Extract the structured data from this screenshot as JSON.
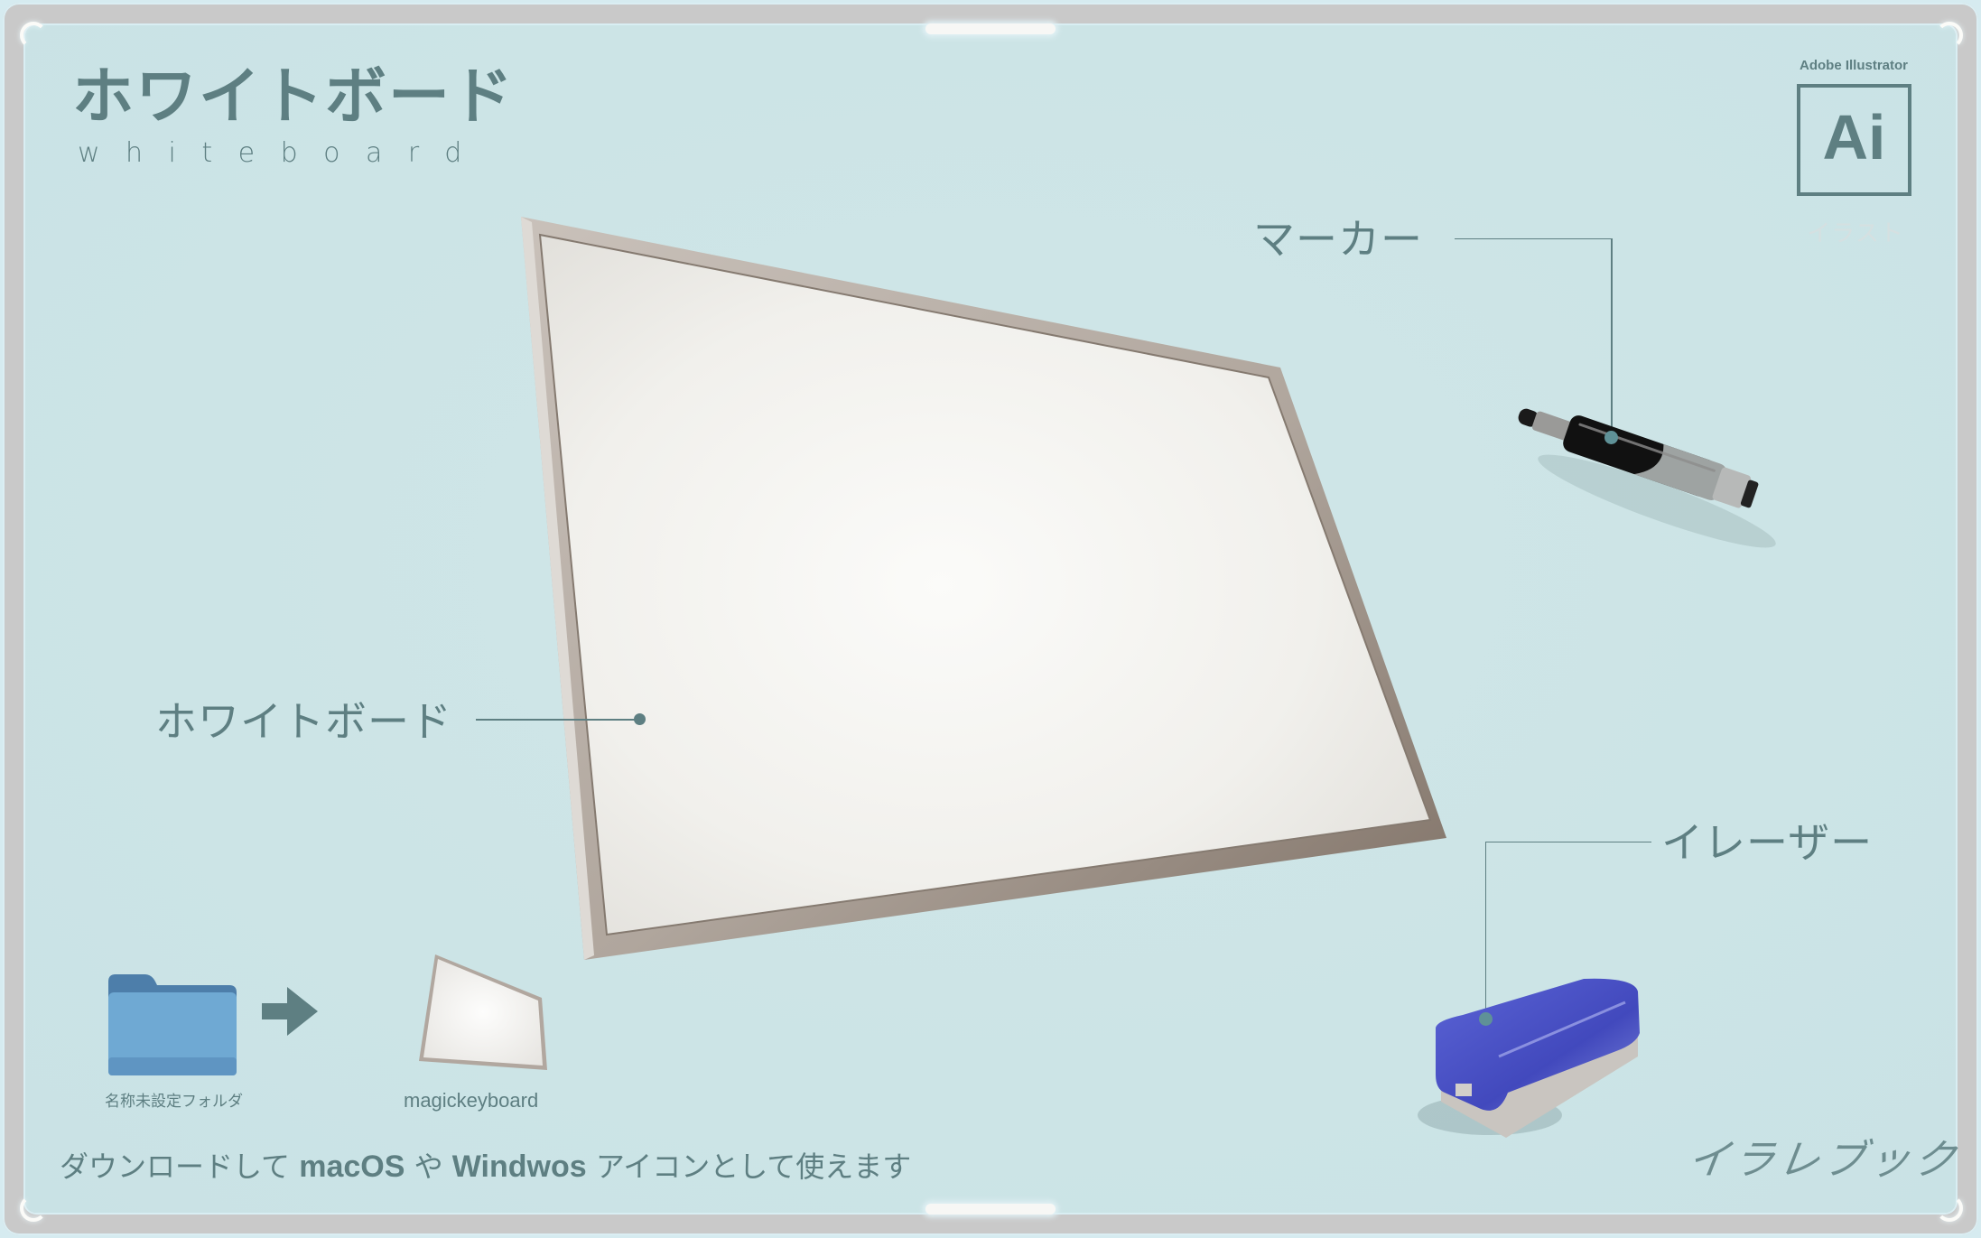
{
  "title": {
    "japanese": "ホワイトボード",
    "english": "whiteboard"
  },
  "brand": {
    "app_name": "Adobe Illustrator",
    "icon_text": "Ai",
    "subtitle": "イラスト"
  },
  "labels": {
    "whiteboard": "ホワイトボード",
    "marker": "マーカー",
    "eraser": "イレーザー"
  },
  "icons": {
    "folder_caption": "名称未設定フォルダ",
    "result_caption": "magickeyboard",
    "arrow": "right-arrow-icon"
  },
  "footer": {
    "prefix": "ダウンロードして ",
    "os1": "macOS",
    "mid": " や ",
    "os2": "Windwos",
    "suffix": " アイコンとして使えます"
  },
  "logo": {
    "text": "イラレブック"
  },
  "colors": {
    "background": "#cce4e6",
    "frame": "#c9c9c9",
    "accent_text": "#5e7f82",
    "board_frame": "#b8aea6",
    "board_frame_dark": "#7d6f64",
    "board_surface": "#f5f4f1",
    "eraser_blue": "#4650c0",
    "folder_blue": "#6fa9d3"
  }
}
